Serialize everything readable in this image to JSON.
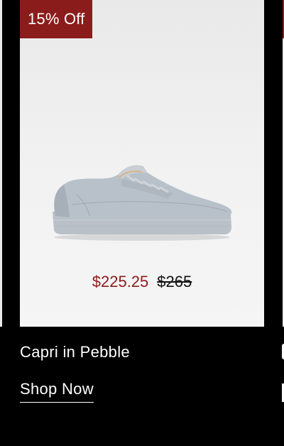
{
  "product": {
    "badge": "15% Off",
    "sale_price": "$225.25",
    "original_price": "$265",
    "name": "Capri in Pebble",
    "cta_label": "Shop Now",
    "image_icon": "sneaker-image"
  },
  "colors": {
    "badge_bg": "#8b1c1c",
    "sale_price": "#8b1c1c",
    "background": "#000000"
  }
}
